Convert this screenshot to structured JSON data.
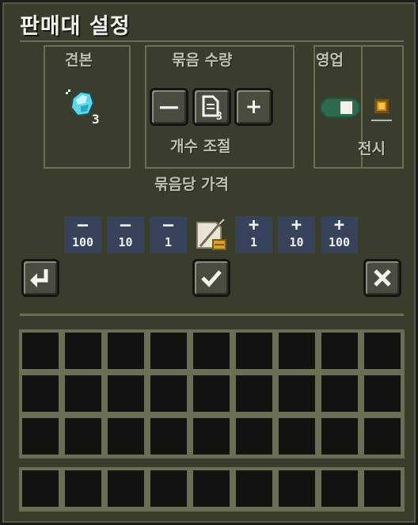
{
  "title": "판매대 설정",
  "sample": {
    "label": "견본",
    "item_icon": "diamond-gem-icon"
  },
  "bundle": {
    "label": "묶음 수량",
    "adjust_label": "개수 조절",
    "minus_icon": "minus-icon",
    "copy_icon": "copy-document-icon",
    "plus_icon": "plus-icon"
  },
  "business": {
    "label": "영업",
    "display_label": "전시"
  },
  "price": {
    "label": "묶음당 가격",
    "buttons": [
      {
        "sign": "—",
        "amount": "100"
      },
      {
        "sign": "—",
        "amount": "10"
      },
      {
        "sign": "—",
        "amount": "1"
      },
      {
        "sign": "+",
        "amount": "1"
      },
      {
        "sign": "+",
        "amount": "10"
      },
      {
        "sign": "+",
        "amount": "100"
      }
    ],
    "edit_icon": "edit-price-icon"
  },
  "actions": {
    "back_icon": "return-arrow-icon",
    "confirm_icon": "checkmark-icon",
    "close_icon": "close-x-icon"
  },
  "colors": {
    "background": "#3a3d2c",
    "border": "#6b6e55",
    "slot": "#121310",
    "price_button": "#36435a",
    "toggle": "#2e6b4e",
    "gem": "#5fd8e6"
  }
}
